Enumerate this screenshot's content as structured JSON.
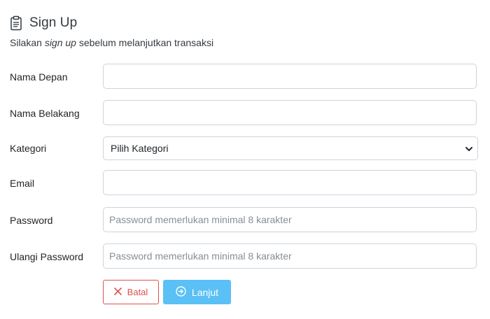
{
  "header": {
    "title": "Sign Up",
    "icon": "clipboard-icon",
    "subtitle_prefix": "Silakan ",
    "subtitle_em": "sign up",
    "subtitle_suffix": " sebelum melanjutkan transaksi"
  },
  "form": {
    "first_name": {
      "label": "Nama Depan",
      "value": "",
      "placeholder": ""
    },
    "last_name": {
      "label": "Nama Belakang",
      "value": "",
      "placeholder": ""
    },
    "category": {
      "label": "Kategori",
      "selected": "Pilih Kategori"
    },
    "email": {
      "label": "Email",
      "value": "",
      "placeholder": ""
    },
    "password": {
      "label": "Password",
      "value": "",
      "placeholder": "Password memerlukan minimal 8 karakter"
    },
    "confirm_password": {
      "label": "Ulangi Password",
      "value": "",
      "placeholder": "Password memerlukan minimal 8 karakter"
    }
  },
  "actions": {
    "cancel_label": "Batal",
    "cancel_icon": "x-icon",
    "next_label": "Lanjut",
    "next_icon": "arrow-circle-right-icon"
  },
  "colors": {
    "danger": "#d9534f",
    "primary": "#5bc0f5",
    "border": "#ced4da"
  }
}
